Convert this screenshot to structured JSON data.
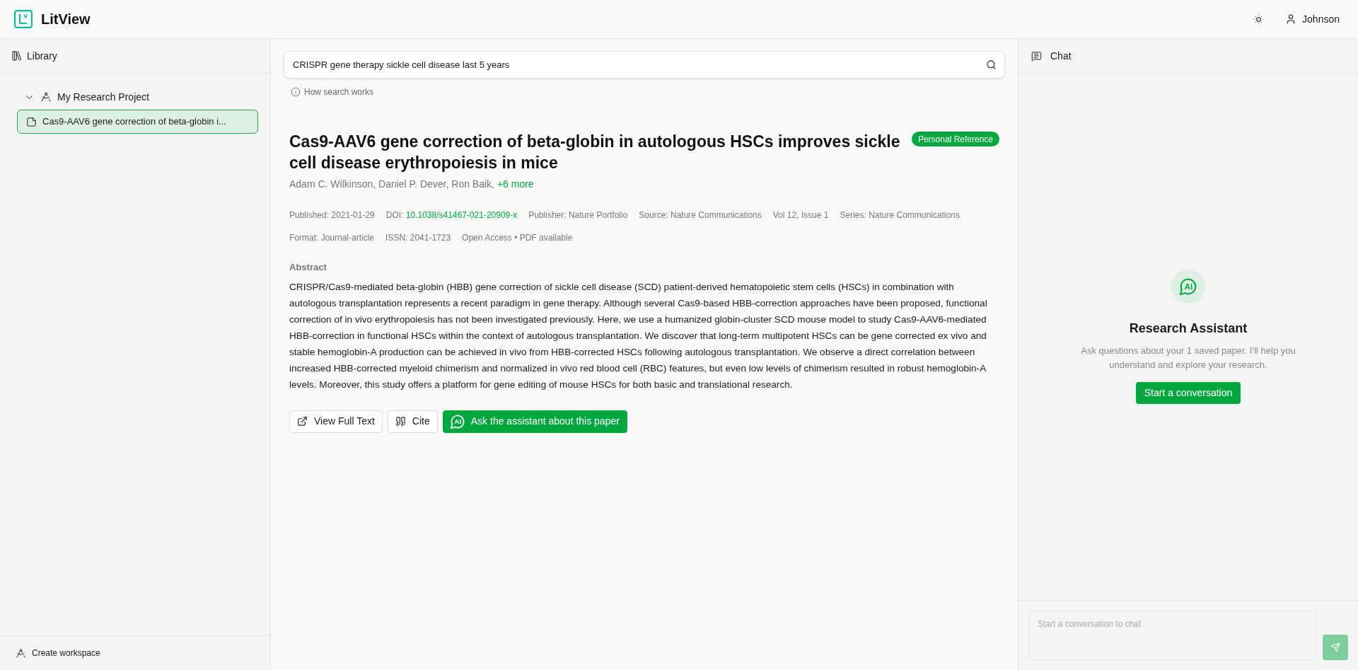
{
  "header": {
    "app_name": "LitView",
    "user_name": "Johnson"
  },
  "sidebar": {
    "title": "Library",
    "tree": [
      {
        "label": "My Research Project",
        "expanded": true,
        "children": [
          {
            "label": "Cas9-AAV6 gene correction of beta-globin i...",
            "selected": true
          }
        ]
      }
    ],
    "footer_action": "Create workspace"
  },
  "search": {
    "value": "CRISPR gene therapy sickle cell disease last 5 years",
    "help_link": "How search works"
  },
  "paper": {
    "title": "Cas9-AAV6 gene correction of beta-globin in autologous HSCs improves sickle cell disease erythropoiesis in mice",
    "badge": "Personal Reference",
    "authors": "Adam C. Wilkinson, Daniel P. Dever, Ron Baik,",
    "more_authors": "+6 more",
    "meta_rows": [
      [
        {
          "kind": "text",
          "text": "Published: 2021-01-29"
        },
        {
          "kind": "link",
          "text": "DOI:",
          "link": "10.1038/s41467-021-20909-x"
        },
        {
          "kind": "text",
          "text": "Publisher: Nature Portfolio"
        },
        {
          "kind": "text",
          "text": "Source: Nature Communications"
        },
        {
          "kind": "text",
          "text": "Vol 12, Issue 1"
        },
        {
          "kind": "text",
          "text": "Series: Nature Communications"
        }
      ],
      [
        {
          "kind": "text",
          "text": "Format: Journal-article"
        },
        {
          "kind": "text",
          "text": "ISSN: 2041-1723"
        },
        {
          "kind": "text",
          "text": "Open Access • PDF available"
        }
      ]
    ],
    "abstract": {
      "heading": "Abstract",
      "text": "CRISPR/Cas9-mediated beta-globin (HBB) gene correction of sickle cell disease (SCD) patient-derived hematopoietic stem cells (HSCs) in combination with autologous transplantation represents a recent paradigm in gene therapy. Although several Cas9-based HBB-correction approaches have been proposed, functional correction of in vivo erythropoiesis has not been investigated previously. Here, we use a humanized globin-cluster SCD mouse model to study Cas9-AAV6-mediated HBB-correction in functional HSCs within the context of autologous transplantation. We discover that long-term multipotent HSCs can be gene corrected ex vivo and stable hemoglobin-A production can be achieved in vivo from HBB-corrected HSCs following autologous transplantation. We observe a direct correlation between increased HBB-corrected myeloid chimerism and normalized in vivo red blood cell (RBC) features, but even low levels of chimerism resulted in robust hemoglobin-A levels. Moreover, this study offers a platform for gene editing of mouse HSCs for both basic and translational research."
    },
    "actions": [
      {
        "kind": "external",
        "label": "View Full Text",
        "primary": false
      },
      {
        "kind": "cite",
        "label": "Cite",
        "primary": false
      },
      {
        "kind": "assistant",
        "label": "Ask the assistant about this paper",
        "primary": true,
        "icon_text": "AI"
      }
    ]
  },
  "chat": {
    "title": "Chat",
    "empty_state": {
      "icon_text": "AI",
      "heading": "Research Assistant",
      "text": "Ask questions about your 1 saved paper. I’ll help you understand and explore your research.",
      "button": "Start a conversation"
    },
    "input": {
      "placeholder": "Start a conversation to chat"
    },
    "send": {
      "disabled": true
    }
  }
}
